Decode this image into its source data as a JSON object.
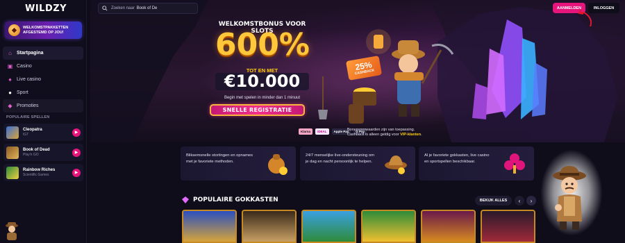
{
  "brand": {
    "logo_text": "WILDZY"
  },
  "promo_banner": {
    "text": "WELKOMSTPAKKETTEN AFGESTEMD OP JOU!",
    "icon": "gift-coin-icon"
  },
  "search": {
    "placeholder": "Zoeken naar",
    "query": "Book of De"
  },
  "header": {
    "register_label": "AANMELDEN",
    "login_label": "INLOGGEN"
  },
  "sidebar": {
    "nav": [
      {
        "label": "Startpagina",
        "icon": "home-icon",
        "active": true
      },
      {
        "label": "Casino",
        "icon": "slot-icon"
      },
      {
        "label": "Live casino",
        "icon": "cards-icon"
      },
      {
        "label": "Sport",
        "icon": "ball-icon"
      },
      {
        "label": "Promoties",
        "icon": "gem-icon"
      }
    ],
    "popular_title": "POPULAIRE SPELLEN",
    "popular_games": [
      {
        "title": "Cleopatra",
        "subtitle": "IGT"
      },
      {
        "title": "Book of Dead",
        "subtitle": "Play'n GO"
      },
      {
        "title": "Rainbow Riches",
        "subtitle": "Scientific Games"
      }
    ]
  },
  "hero": {
    "title": "WELKOMSTBONUS VOOR SLOTS",
    "big_value": "600%",
    "up_to_label": "TOT EN MET",
    "amount": "€10.000",
    "tagline": "Begin met spelen in minder dan 1 minuut",
    "cta_label": "SNELLE REGISTRATIE",
    "cashback_pct": "25%",
    "cashback_label": "CASHBACK",
    "payments": [
      "Klarna",
      "iDEAL",
      "Apple Pay",
      "G Pay"
    ],
    "terms_line1": "Bonusvoorwaarden zijn van toepassing.",
    "terms_line2_pre": "Cashback is alleen geldig voor ",
    "terms_line2_bold": "VIP-klanten",
    "terms_line2_post": "."
  },
  "features": [
    {
      "text": "Bliksemsnelle stortingen en opnames met je favoriete methoden.",
      "icon": "money-bag-icon"
    },
    {
      "text": "24/7 menselijke live-ondersteuning om je dag en nacht persoonlijk te helpen.",
      "icon": "treasure-hat-icon"
    },
    {
      "text": "Al je favoriete gokkasten, live casino en sportspellen beschikbaar.",
      "icon": "clover-card-icon"
    }
  ],
  "popular_slots": {
    "heading": "POPULAIRE GOKKASTEN",
    "see_all_label": "BEKIJK ALLES",
    "prev_arrow": "‹",
    "next_arrow": "›"
  },
  "colors": {
    "accent": "#e6157c",
    "gold": "#ffc83a",
    "background": "#0f0d1a"
  }
}
